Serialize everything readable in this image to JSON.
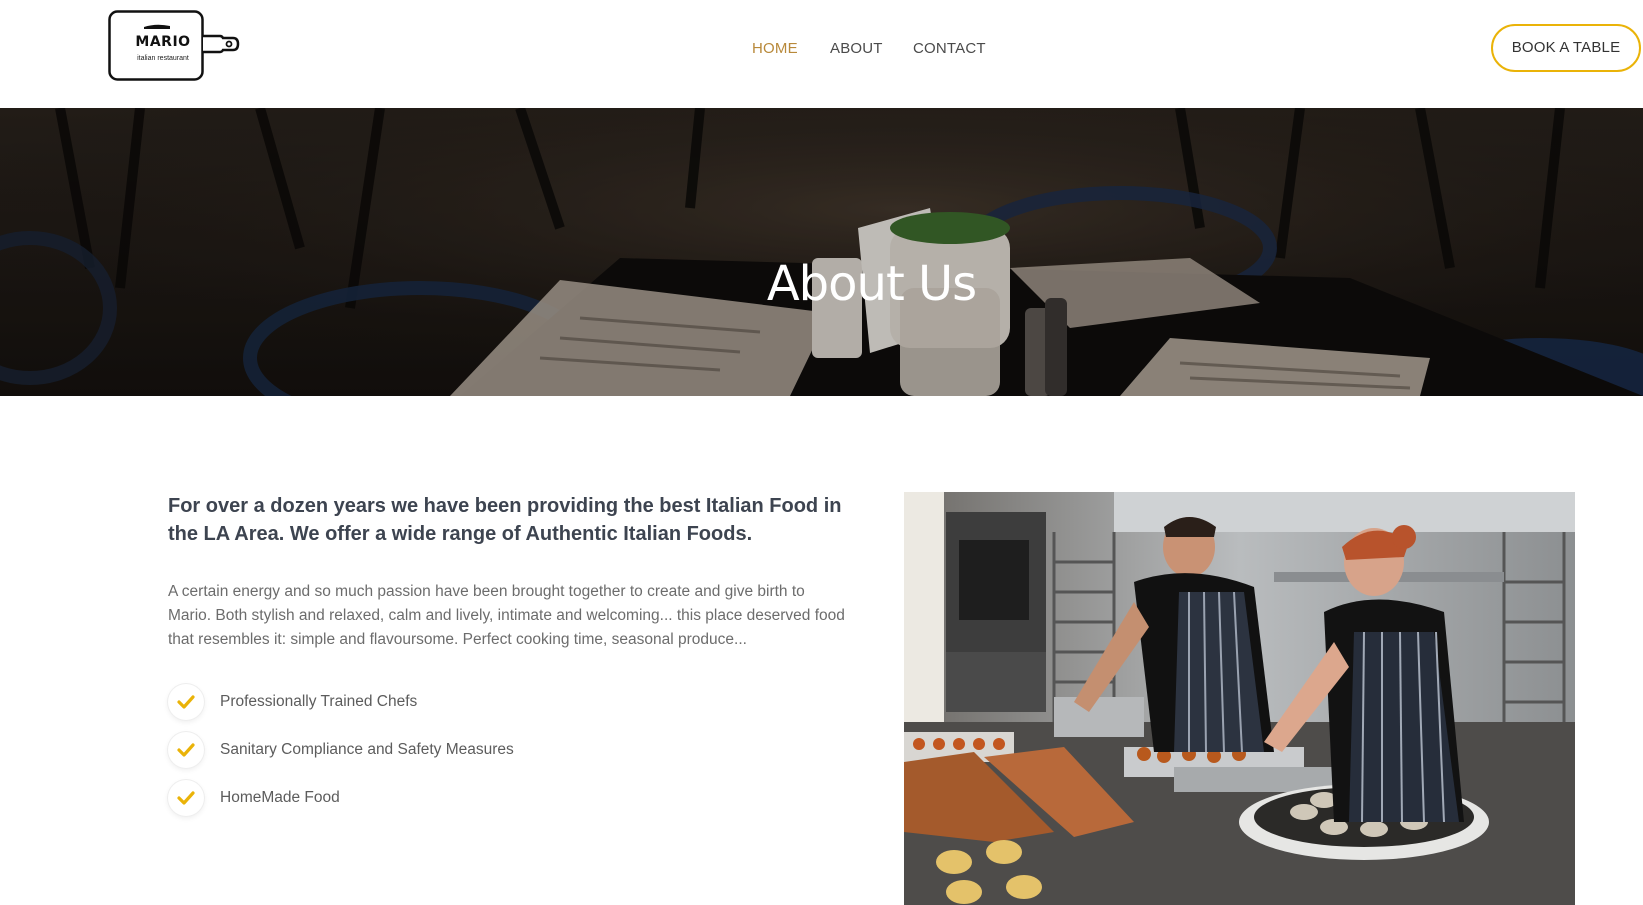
{
  "brand": {
    "name": "MARIO",
    "tagline": "italian restaurant"
  },
  "nav": {
    "items": [
      {
        "label": "HOME",
        "active": true
      },
      {
        "label": "ABOUT",
        "active": false
      },
      {
        "label": "CONTACT",
        "active": false
      }
    ],
    "cta_label": "BOOK A TABLE"
  },
  "hero": {
    "title": "About Us"
  },
  "about": {
    "lead": "For over a dozen years we have been providing the best Italian Food in the LA Area. We offer a wide range of Authentic Italian Foods.",
    "body": "A certain energy and so much passion have been brought together to create and give birth to Mario. Both stylish and relaxed, calm and lively, intimate and welcoming... this place deserved food that resembles it: simple and flavoursome. Perfect cooking time, seasonal produce...",
    "features": [
      {
        "label": "Professionally Trained Chefs",
        "icon": "check-icon"
      },
      {
        "label": "Sanitary Compliance and Safety Measures",
        "icon": "check-icon"
      },
      {
        "label": "HomeMade Food",
        "icon": "check-icon"
      }
    ]
  },
  "colors": {
    "accent": "#eab308",
    "active_nav": "#b8893a",
    "heading": "#3d4450",
    "body": "#6c6c6c"
  }
}
